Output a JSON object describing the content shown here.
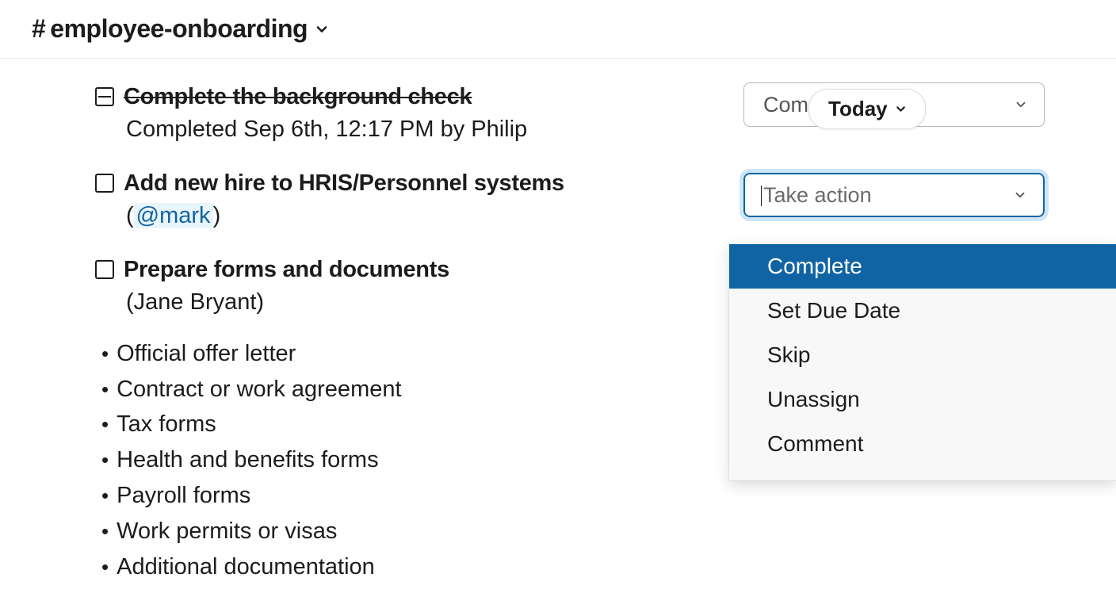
{
  "header": {
    "channel_name": "employee-onboarding"
  },
  "tasks": [
    {
      "title": "Complete the background check",
      "completed": true,
      "sub": "Completed Sep 6th, 12:17 PM by Philip"
    },
    {
      "title": "Add new hire to HRIS/Personnel systems",
      "completed": false,
      "assignee_mention": "@mark",
      "paren_open": "(",
      "paren_close": ")"
    },
    {
      "title": "Prepare forms and documents",
      "completed": false,
      "assignee_plain": "(Jane Bryant)"
    }
  ],
  "bullets": [
    "Official offer letter",
    "Contract or work agreement",
    "Tax forms",
    "Health and benefits forms",
    "Payroll forms",
    "Work permits or visas",
    "Additional documentation"
  ],
  "right": {
    "completed_dropdown": "Compl...",
    "take_action_placeholder": "Take action"
  },
  "today_pill": "Today",
  "menu": {
    "items": [
      "Complete",
      "Set Due Date",
      "Skip",
      "Unassign",
      "Comment"
    ],
    "highlighted_index": 0
  }
}
